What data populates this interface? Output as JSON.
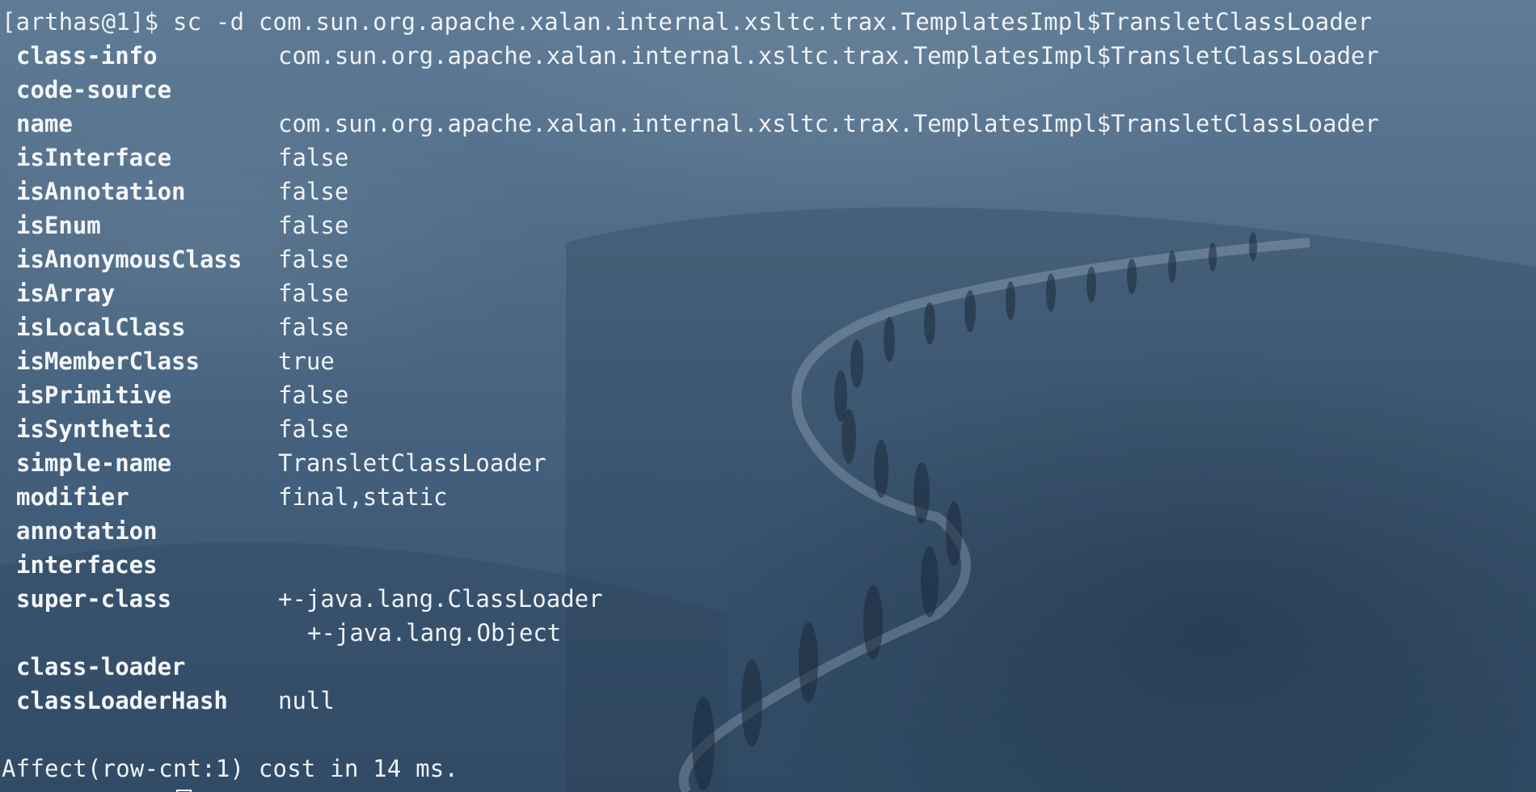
{
  "terminal": {
    "prompt": "[arthas@1]$",
    "command": " sc -d com.sun.org.apache.xalan.internal.xsltc.trax.TemplatesImpl$TransletClassLoader",
    "rows": [
      {
        "key": "class-info",
        "value": "com.sun.org.apache.xalan.internal.xsltc.trax.TemplatesImpl$TransletClassLoader"
      },
      {
        "key": "code-source",
        "value": ""
      },
      {
        "key": "name",
        "value": "com.sun.org.apache.xalan.internal.xsltc.trax.TemplatesImpl$TransletClassLoader"
      },
      {
        "key": "isInterface",
        "value": "false"
      },
      {
        "key": "isAnnotation",
        "value": "false"
      },
      {
        "key": "isEnum",
        "value": "false"
      },
      {
        "key": "isAnonymousClass",
        "value": "false"
      },
      {
        "key": "isArray",
        "value": "false"
      },
      {
        "key": "isLocalClass",
        "value": "false"
      },
      {
        "key": "isMemberClass",
        "value": "true"
      },
      {
        "key": "isPrimitive",
        "value": "false"
      },
      {
        "key": "isSynthetic",
        "value": "false"
      },
      {
        "key": "simple-name",
        "value": "TransletClassLoader"
      },
      {
        "key": "modifier",
        "value": "final,static"
      },
      {
        "key": "annotation",
        "value": ""
      },
      {
        "key": "interfaces",
        "value": ""
      },
      {
        "key": "super-class",
        "value": "+-java.lang.ClassLoader"
      },
      {
        "key": "",
        "value": "+-java.lang.Object"
      },
      {
        "key": "class-loader",
        "value": ""
      },
      {
        "key": "classLoaderHash",
        "value": "null"
      }
    ],
    "footer": "Affect(row-cnt:1) cost in 14 ms."
  },
  "colors": {
    "text": "#eef2f6",
    "background": "#4e6a86"
  }
}
